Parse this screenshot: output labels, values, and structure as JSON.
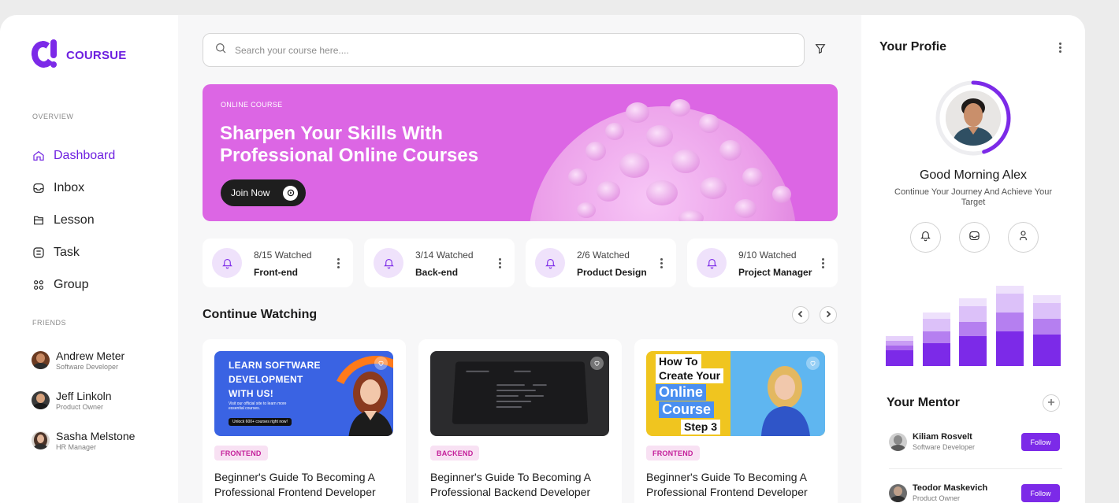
{
  "brand": {
    "name": "COURSUE",
    "accent": "#7c2ae8"
  },
  "sidebar": {
    "overview_label": "OVERVIEW",
    "items": [
      {
        "label": "Dashboard",
        "icon": "home-icon",
        "active": true
      },
      {
        "label": "Inbox",
        "icon": "inbox-icon"
      },
      {
        "label": "Lesson",
        "icon": "book-icon"
      },
      {
        "label": "Task",
        "icon": "task-icon"
      },
      {
        "label": "Group",
        "icon": "group-icon"
      }
    ],
    "friends_label": "FRIENDS",
    "friends": [
      {
        "name": "Andrew Meter",
        "role": "Software Developer"
      },
      {
        "name": "Jeff Linkoln",
        "role": "Product Owner"
      },
      {
        "name": "Sasha Melstone",
        "role": "HR Manager"
      }
    ]
  },
  "search": {
    "placeholder": "Search your course here...."
  },
  "banner": {
    "eyebrow": "ONLINE COURSE",
    "title": "Sharpen Your Skills With Professional Online Courses",
    "cta": "Join Now",
    "color": "#dc66e4"
  },
  "progress": [
    {
      "count": "8/15 Watched",
      "title": "Front-end"
    },
    {
      "count": "3/14 Watched",
      "title": "Back-end"
    },
    {
      "count": "2/6 Watched",
      "title": "Product Design"
    },
    {
      "count": "9/10 Watched",
      "title": "Project Manager"
    }
  ],
  "continue_watching": {
    "title": "Continue Watching",
    "courses": [
      {
        "tag": "FRONTEND",
        "title": "Beginner's Guide To Becoming A Professional Frontend Developer",
        "thumb": {
          "lines": [
            "LEARN SOFTWARE",
            "DEVELOPMENT",
            "WITH US!"
          ],
          "sub": "Visit our official site to learn more essential courses.",
          "pill": "Unlock 600+ courses right now!"
        }
      },
      {
        "tag": "BACKEND",
        "title": "Beginner's Guide To Becoming A Professional Backend Developer"
      },
      {
        "tag": "FRONTEND",
        "title": "Beginner's Guide To Becoming A Professional Frontend Developer",
        "thumb": {
          "lines": [
            "How To",
            "Create Your",
            "Online",
            "Course",
            "Step 3"
          ]
        }
      }
    ]
  },
  "profile": {
    "title": "Your Profie",
    "greeting": "Good Morning Alex",
    "subtitle": "Continue Your Journey And Achieve Your Target",
    "progress_fraction": 0.45
  },
  "mentors": {
    "title": "Your Mentor",
    "list": [
      {
        "name": "Kiliam Rosvelt",
        "role": "Software Developer",
        "action": "Follow"
      },
      {
        "name": "Teodor Maskevich",
        "role": "Product Owner",
        "action": "Follow"
      }
    ]
  }
}
